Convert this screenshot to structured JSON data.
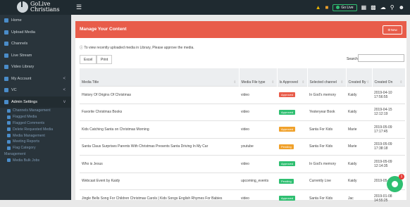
{
  "brand": {
    "line1": "GoLive",
    "line2": "Christians"
  },
  "topbar": {
    "golive_label": "Go Live",
    "status_color": "#2fbf71"
  },
  "sidebar": {
    "items": [
      {
        "label": "Home",
        "icon": "home-icon",
        "chev": ""
      },
      {
        "label": "Upload Media",
        "icon": "cloud-upload-icon",
        "chev": ""
      },
      {
        "label": "Channels",
        "icon": "bars-icon",
        "chev": ""
      },
      {
        "label": "Live Stream",
        "icon": "broadcast-icon",
        "chev": ""
      },
      {
        "label": "Video Library",
        "icon": "video-icon",
        "chev": ""
      },
      {
        "label": "My Account",
        "icon": "user-icon",
        "chev": "<"
      },
      {
        "label": "VC",
        "icon": "gear-icon",
        "chev": "<"
      },
      {
        "label": "Admin Settings",
        "icon": "gear-icon",
        "chev": "v"
      }
    ],
    "subitems": [
      "Channels Management",
      "Flagged Media",
      "Flagged Comments",
      "Delete Requested Media",
      "Media Management",
      "Meeting Reports",
      "Flag Category",
      "Management",
      "Media Bulk Jobs"
    ]
  },
  "panel": {
    "title": "Manage Your Content",
    "new_button": "New",
    "info": "To view recently uploaded media in Library, Please approve the media.",
    "excel": "Excel",
    "print": "Print",
    "search_label": "Search:"
  },
  "table": {
    "headers": [
      "Media Title",
      "Media File type",
      "Is Approved",
      "Selected channel",
      "Created By",
      "Created On"
    ],
    "rows": [
      {
        "title": "History Of Origins Of Christmas",
        "type": "video",
        "status": "Approved",
        "status_color": "#e85c4a",
        "channel": "In God's memory",
        "by": "Kaidy",
        "on": "2019-04-10 17:56:55"
      },
      {
        "title": "Favorite Christmas Books",
        "type": "video",
        "status": "Approved",
        "status_color": "#2fbf71",
        "channel": "Yesteryear Book",
        "by": "Kaidy",
        "on": "2019-04-15 12:12:19"
      },
      {
        "title": "Kids Catching Santa on Christmas Morning",
        "type": "video",
        "status": "Approved",
        "status_color": "#f0a12b",
        "channel": "Santa For Kids",
        "by": "Marie",
        "on": "2019-05-09 17:17:45"
      },
      {
        "title": "Santa Claus Surprises Parents With Christmas Presents Santa Driving In My Car",
        "type": "youtube",
        "status": "Pending",
        "status_color": "#f0a12b",
        "channel": "Santa For Kids",
        "by": "Marie",
        "on": "2019-05-09 17:38:18"
      },
      {
        "title": "Who is Jesus",
        "type": "video",
        "status": "Approved",
        "status_color": "#2fbf71",
        "channel": "In God's memory",
        "by": "Kaidy",
        "on": "2019-05-09 12:14:35"
      },
      {
        "title": "Webcast Event by Kaidy",
        "type": "upcoming_events",
        "status": "Pending",
        "status_color": "#2fbf71",
        "channel": "Currently Live",
        "by": "Kaidy",
        "on": "2019-05-0 11:18:"
      },
      {
        "title": "Jingle Bells Song For Children Christmas Carols | Kids Songs English Rhymes For Babies",
        "type": "video",
        "status": "Approved",
        "status_color": "#2fbf71",
        "channel": "Santa For Kids",
        "by": "Jac",
        "on": "2019-01-08 14:55:25"
      }
    ]
  },
  "chat": {
    "badge": "1"
  }
}
